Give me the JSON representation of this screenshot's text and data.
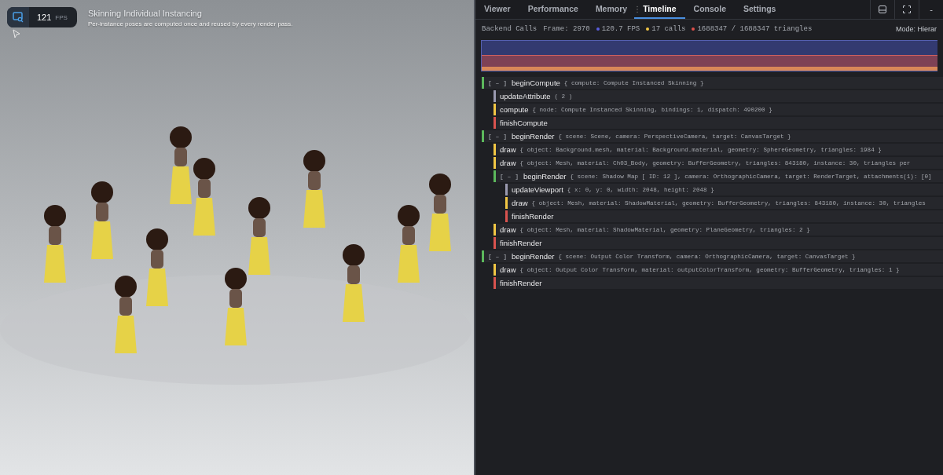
{
  "viewport": {
    "kind": "picture",
    "fps": {
      "value": "121",
      "unit": "FPS"
    },
    "title": "Skinning Individual Instancing",
    "subtitle": "Per-instance poses are computed once and reused by every render pass."
  },
  "inspector": {
    "tabs": [
      {
        "label": "Viewer",
        "selected": false
      },
      {
        "label": "Performance",
        "selected": false
      },
      {
        "label": "Memory",
        "selected": false
      },
      {
        "label": "Timeline",
        "selected": true
      },
      {
        "label": "Console",
        "selected": false
      },
      {
        "label": "Settings",
        "selected": false
      }
    ],
    "window_buttons": [
      "-"
    ],
    "stats": {
      "title": "Backend Calls",
      "frame": "Frame: 2970",
      "items": [
        {
          "text": "120.7 FPS",
          "color": "#5a5ee0"
        },
        {
          "text": "17 calls",
          "color": "#f2c744"
        },
        {
          "text": "1688347 / 1688347 triangles",
          "color": "#e0504a"
        }
      ],
      "mode": "Mode: Hierar"
    },
    "calls": [
      {
        "kind": "group",
        "toggle": "[ – ]",
        "name": "beginCompute",
        "color": "#5cb85c",
        "args": "{ compute: Compute Instanced Skinning }",
        "children": [
          {
            "kind": "call",
            "name": "updateAttribute",
            "color": "#9a9ab0",
            "args": "( 2 )"
          },
          {
            "kind": "call",
            "name": "compute",
            "color": "#f2c744",
            "args": "{ node: Compute Instanced Skinning, bindings: 1, dispatch: 490200 }"
          },
          {
            "kind": "call",
            "name": "finishCompute",
            "color": "#d9534f"
          }
        ]
      },
      {
        "kind": "group",
        "toggle": "[ – ]",
        "name": "beginRender",
        "color": "#5cb85c",
        "args": "{ scene: Scene, camera: PerspectiveCamera, target: CanvasTarget }",
        "children": [
          {
            "kind": "call",
            "name": "draw",
            "color": "#f2c744",
            "args": "{ object: Background.mesh, material: Background.material, geometry: SphereGeometry, triangles: 1984 }"
          },
          {
            "kind": "call",
            "name": "draw",
            "color": "#f2c744",
            "args": "{ object: Mesh, material: Ch03_Body, geometry: BufferGeometry, triangles: 843180, instance: 30, triangles per"
          },
          {
            "kind": "group",
            "toggle": "[ – ]",
            "name": "beginRender",
            "color": "#5cb85c",
            "args": "{ scene: Shadow Map [ ID: 12 ], camera: OrthographicCamera, target: RenderTarget, attachments(1): [0]",
            "children": [
              {
                "kind": "call",
                "name": "updateViewport",
                "color": "#9a9ab0",
                "args": "{ x: 0, y: 0, width: 2048, height: 2048 }"
              },
              {
                "kind": "call",
                "name": "draw",
                "color": "#f2c744",
                "args": "{ object: Mesh, material: ShadowMaterial, geometry: BufferGeometry, triangles: 843180, instance: 30, triangles"
              },
              {
                "kind": "call",
                "name": "finishRender",
                "color": "#d9534f"
              }
            ]
          },
          {
            "kind": "call",
            "name": "draw",
            "color": "#f2c744",
            "args": "{ object: Mesh, material: ShadowMaterial, geometry: PlaneGeometry, triangles: 2 }"
          },
          {
            "kind": "call",
            "name": "finishRender",
            "color": "#d9534f"
          }
        ]
      },
      {
        "kind": "group",
        "toggle": "[ – ]",
        "name": "beginRender",
        "color": "#5cb85c",
        "args": "{ scene: Output Color Transform, camera: OrthographicCamera, target: CanvasTarget }",
        "children": [
          {
            "kind": "call",
            "name": "draw",
            "color": "#f2c744",
            "args": "{ object: Output Color Transform, material: outputColorTransform, geometry: BufferGeometry, triangles: 1 }"
          },
          {
            "kind": "call",
            "name": "finishRender",
            "color": "#d9534f"
          }
        ]
      }
    ]
  }
}
